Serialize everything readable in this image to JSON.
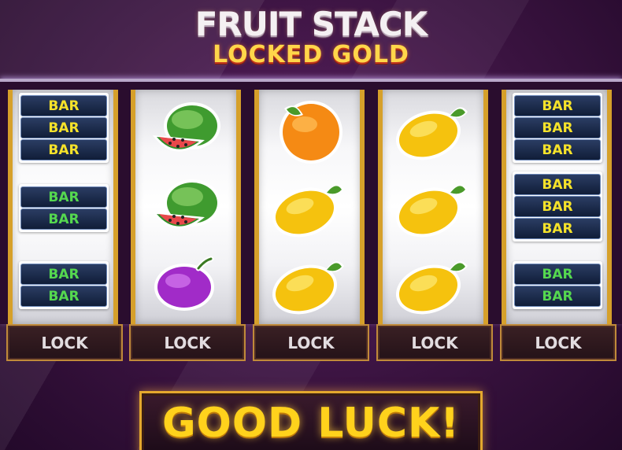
{
  "logo": {
    "title_line1": "FRUIT STACK",
    "title_line2": "LOCKED GOLD"
  },
  "reels": [
    {
      "name": "reel-1",
      "bar_groups": [
        {
          "labels": [
            "BAR",
            "BAR",
            "BAR"
          ],
          "color": "yellow"
        },
        {
          "labels": [
            "BAR",
            "BAR"
          ],
          "color": "green"
        },
        {
          "labels": [
            "BAR",
            "BAR"
          ],
          "color": "green"
        }
      ]
    },
    {
      "name": "reel-2",
      "symbols": [
        "watermelon-icon",
        "watermelon-icon",
        "plum-icon"
      ]
    },
    {
      "name": "reel-3",
      "symbols": [
        "orange-icon",
        "lemon-icon",
        "lemon-icon"
      ]
    },
    {
      "name": "reel-4",
      "symbols": [
        "lemon-icon",
        "lemon-icon",
        "lemon-icon"
      ]
    },
    {
      "name": "reel-5",
      "bar_groups": [
        {
          "labels": [
            "BAR",
            "BAR",
            "BAR"
          ],
          "color": "yellow"
        },
        {
          "labels": [
            "BAR",
            "BAR",
            "BAR"
          ],
          "color": "yellow"
        },
        {
          "labels": [
            "BAR",
            "BAR"
          ],
          "color": "green"
        }
      ]
    }
  ],
  "lock_buttons": [
    "LOCK",
    "LOCK",
    "LOCK",
    "LOCK",
    "LOCK"
  ],
  "message": "GOOD LUCK!",
  "colors": {
    "bar_yellow": "#f5e22a",
    "bar_green": "#55d84f",
    "gold_frame": "#d6a02a",
    "message_text": "#ffd21c",
    "background": "#3a1340"
  }
}
